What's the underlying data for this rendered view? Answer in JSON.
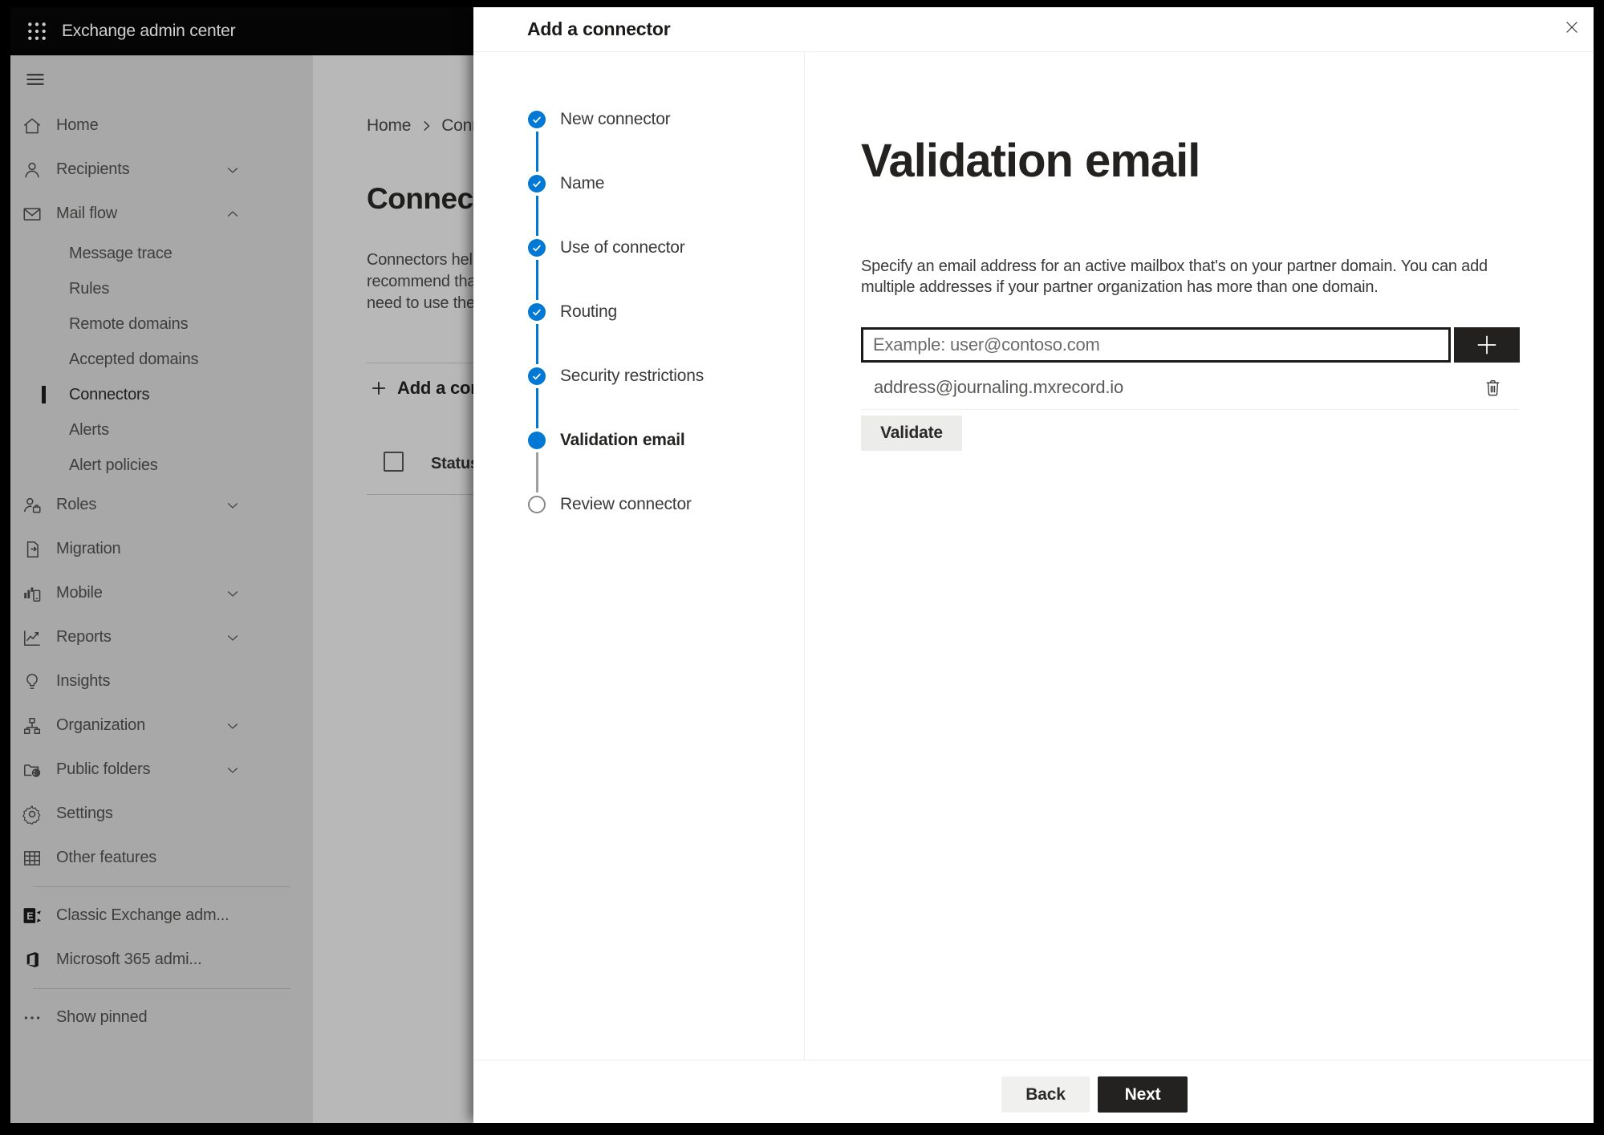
{
  "topbar": {
    "title": "Exchange admin center"
  },
  "sidebar": {
    "items": [
      {
        "label": "Home",
        "icon": "home"
      },
      {
        "label": "Recipients",
        "icon": "person",
        "chevron": "down"
      },
      {
        "label": "Mail flow",
        "icon": "mail",
        "chevron": "up"
      },
      {
        "label": "Message trace",
        "sub": true
      },
      {
        "label": "Rules",
        "sub": true
      },
      {
        "label": "Remote domains",
        "sub": true
      },
      {
        "label": "Accepted domains",
        "sub": true
      },
      {
        "label": "Connectors",
        "sub": true,
        "selected": true
      },
      {
        "label": "Alerts",
        "sub": true
      },
      {
        "label": "Alert policies",
        "sub": true
      },
      {
        "label": "Roles",
        "icon": "roles",
        "chevron": "down"
      },
      {
        "label": "Migration",
        "icon": "migration"
      },
      {
        "label": "Mobile",
        "icon": "mobile",
        "chevron": "down"
      },
      {
        "label": "Reports",
        "icon": "reports",
        "chevron": "down"
      },
      {
        "label": "Insights",
        "icon": "insights"
      },
      {
        "label": "Organization",
        "icon": "org",
        "chevron": "down"
      },
      {
        "label": "Public folders",
        "icon": "folders",
        "chevron": "down"
      },
      {
        "label": "Settings",
        "icon": "settings"
      },
      {
        "label": "Other features",
        "icon": "grid"
      },
      {
        "divider": true
      },
      {
        "label": "Classic Exchange adm...",
        "icon": "exchange"
      },
      {
        "label": "Microsoft 365 admi...",
        "icon": "office"
      },
      {
        "divider": true
      },
      {
        "label": "Show pinned",
        "icon": "dots"
      }
    ]
  },
  "page": {
    "breadcrumb_home": "Home",
    "breadcrumb_current": "Connectors",
    "title": "Connectors",
    "intro_lines": [
      "Connectors help",
      "recommend that",
      "need to use ther"
    ],
    "add_button": "Add a connector",
    "status_header": "Status"
  },
  "dialog": {
    "title": "Add a connector",
    "steps": [
      {
        "label": "New connector",
        "state": "done"
      },
      {
        "label": "Name",
        "state": "done"
      },
      {
        "label": "Use of connector",
        "state": "done"
      },
      {
        "label": "Routing",
        "state": "done"
      },
      {
        "label": "Security restrictions",
        "state": "done"
      },
      {
        "label": "Validation email",
        "state": "current"
      },
      {
        "label": "Review connector",
        "state": "upcoming"
      }
    ],
    "heading": "Validation email",
    "description": "Specify an email address for an active mailbox that's on your partner domain. You can add multiple addresses if your partner organization has more than one domain.",
    "email_placeholder": "Example: user@contoso.com",
    "address": "address@journaling.mxrecord.io",
    "validate_label": "Validate",
    "back_label": "Back",
    "next_label": "Next"
  },
  "colors": {
    "accent_blue": "#0078d4",
    "dark_button": "#232221",
    "topbar_bg": "#050505"
  }
}
